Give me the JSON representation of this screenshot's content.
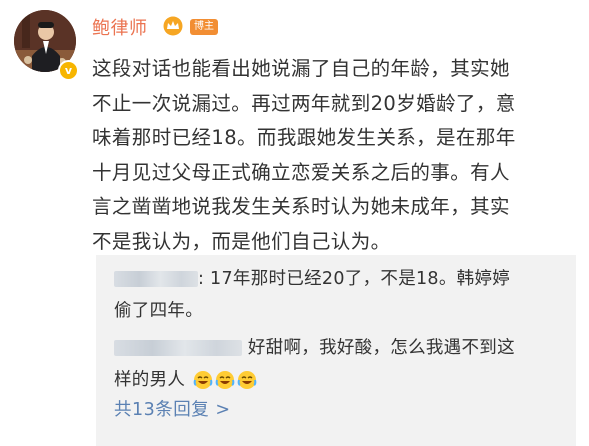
{
  "author": {
    "name": "鲍律师",
    "badge": "博主",
    "verified_icon": "v-icon",
    "crown_icon": "crown-icon"
  },
  "post_lines": [
    "这段对话也能看出她说漏了自己的年龄，其实她",
    "不止一次说漏过。再过两年就到20岁婚龄了，意",
    "味着那时已经18。而我跟她发生关系，是在那年",
    "十月见过父母正式确立恋爱关系之后的事。有人",
    "言之凿凿地说我发生关系时认为她未成年，其实",
    "不是我认为，而是他们自己认为。"
  ],
  "comments": [
    {
      "line1": ": 17年那时已经20了，不是18。韩婷婷",
      "line2": "偷了四年。"
    },
    {
      "line1": "好甜啊，我好酸，怎么我遇不到这",
      "line2": "样的男人",
      "emoji_icon": "crying-laughing-icon",
      "emoji_count": 3
    }
  ],
  "more_replies": "共13条回复 >",
  "colors": {
    "name": "#eb7350",
    "link": "#5b81b3",
    "comment_bg": "#f2f2f2",
    "badge": "#f28e33"
  }
}
